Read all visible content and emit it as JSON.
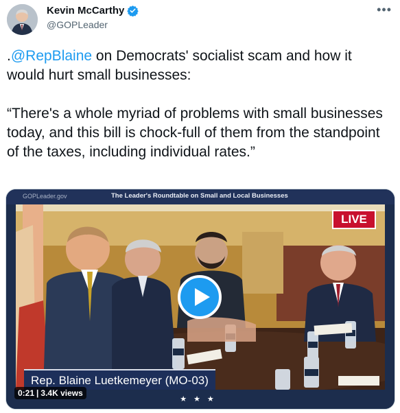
{
  "author": {
    "display_name": "Kevin McCarthy",
    "handle": "@GOPLeader",
    "verified_icon": "verified-badge-icon"
  },
  "more_icon": "more-options-icon",
  "tweet": {
    "prefix": ".",
    "mention": "@RepBlaine",
    "text_after_mention": " on Democrats' socialist scam and how it would hurt small businesses:\n\n“There's a whole myriad of problems with small businesses today, and this bill is chock-full of them from the standpoint of the taxes, including individual rates.”"
  },
  "video": {
    "site_label": "GOPLeader.gov",
    "banner_title": "The Leader's Roundtable on Small and Local Businesses",
    "live_badge": "LIVE",
    "lower_third": "Rep. Blaine Luetkemeyer (MO-03)",
    "footer_stars": "★★★",
    "duration": "0:21",
    "separator": "|",
    "views": "3.4K views",
    "play_icon": "play-icon"
  },
  "colors": {
    "accent": "#1d9bf0",
    "live_red": "#c8102e",
    "navy": "#1d2f5a"
  }
}
